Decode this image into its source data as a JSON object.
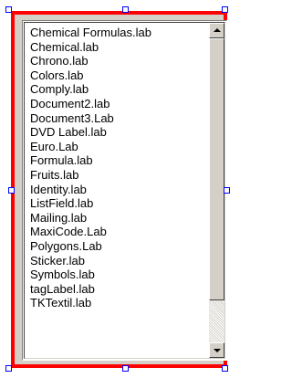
{
  "listbox": {
    "items": [
      "Chemical Formulas.lab",
      "Chemical.lab",
      "Chrono.lab",
      "Colors.lab",
      "Comply.lab",
      "Document2.lab",
      "Document3.Lab",
      "DVD Label.lab",
      "Euro.Lab",
      "Formula.lab",
      "Fruits.lab",
      "Identity.lab",
      "ListField.lab",
      "Mailing.lab",
      "MaxiCode.Lab",
      "Polygons.Lab",
      "Sticker.lab",
      "Symbols.lab",
      "tagLabel.lab",
      "TKTextil.lab"
    ]
  },
  "colors": {
    "selection_border": "#ff0000",
    "handle_border": "#0000ff"
  },
  "icons": {
    "scroll_up": "arrow-up-icon",
    "scroll_down": "arrow-down-icon"
  }
}
